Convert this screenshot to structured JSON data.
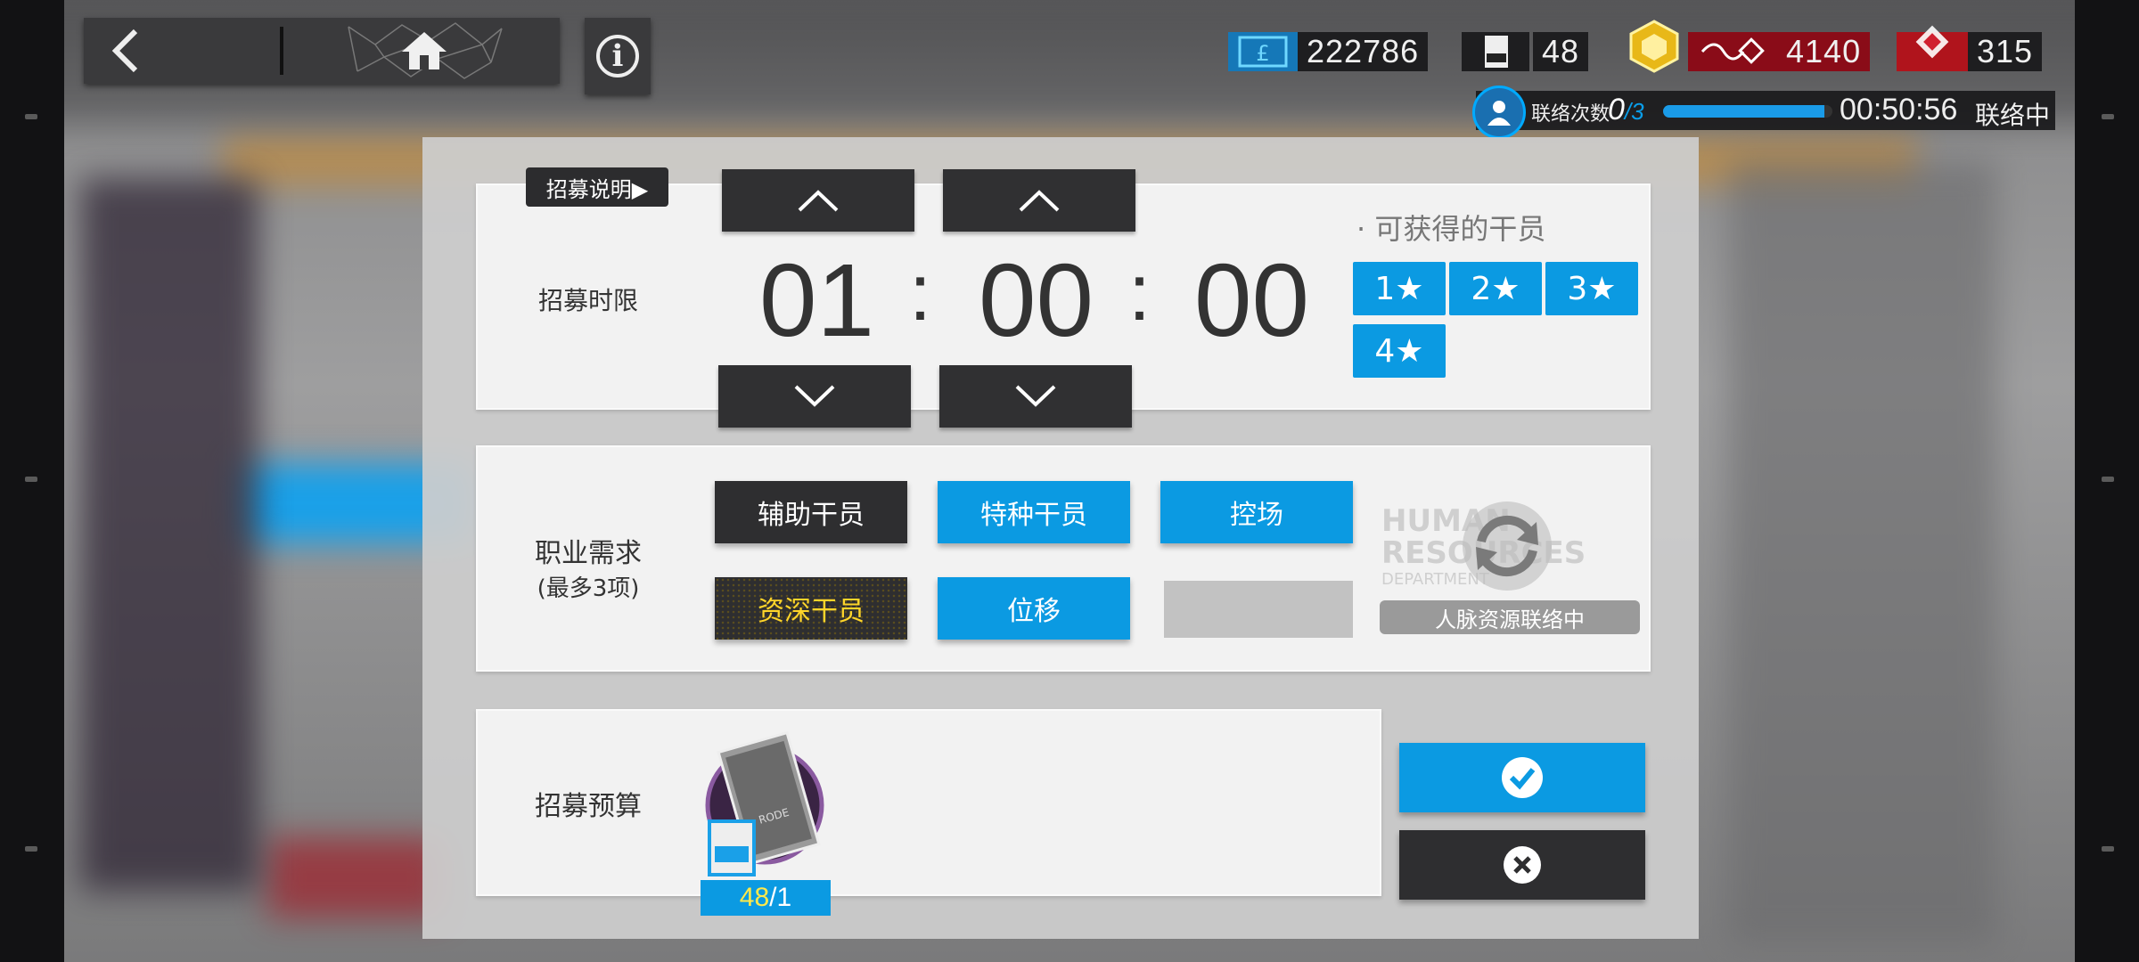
{
  "nav": {
    "back_icon": "back-arrow-icon",
    "home_icon": "home-icon",
    "info_icon": "info-icon"
  },
  "resources": {
    "lmd": "222786",
    "recruit_permits": "48",
    "orundum": "4140",
    "originite_prime": "315"
  },
  "contact": {
    "label": "联络次数",
    "count": "0",
    "max": "/3",
    "progress": 0.95,
    "timer": "00:50:56",
    "status": "联络中"
  },
  "recruit": {
    "explain_label": "招募说明▶",
    "time_limit_label": "招募时限",
    "hours": "01",
    "minutes": "00",
    "seconds": "00",
    "colon": ":",
    "available_label": "· 可获得的干员",
    "stars": [
      "1★",
      "2★",
      "3★",
      "4★"
    ],
    "job_label": "职业需求",
    "job_sublabel": "(最多3项)",
    "tags": [
      "辅助干员",
      "特种干员",
      "控场",
      "资深干员",
      "位移"
    ],
    "hr_logo_text": "HUMAN RESOURCES DEPARTMENT",
    "hr_status": "人脉资源联络中",
    "budget_label": "招募预算",
    "budget_current": "48",
    "budget_cost": "/1"
  },
  "colors": {
    "accent": "#0b9ae2",
    "dark": "#2e2e30",
    "gold": "#ffd52a"
  }
}
